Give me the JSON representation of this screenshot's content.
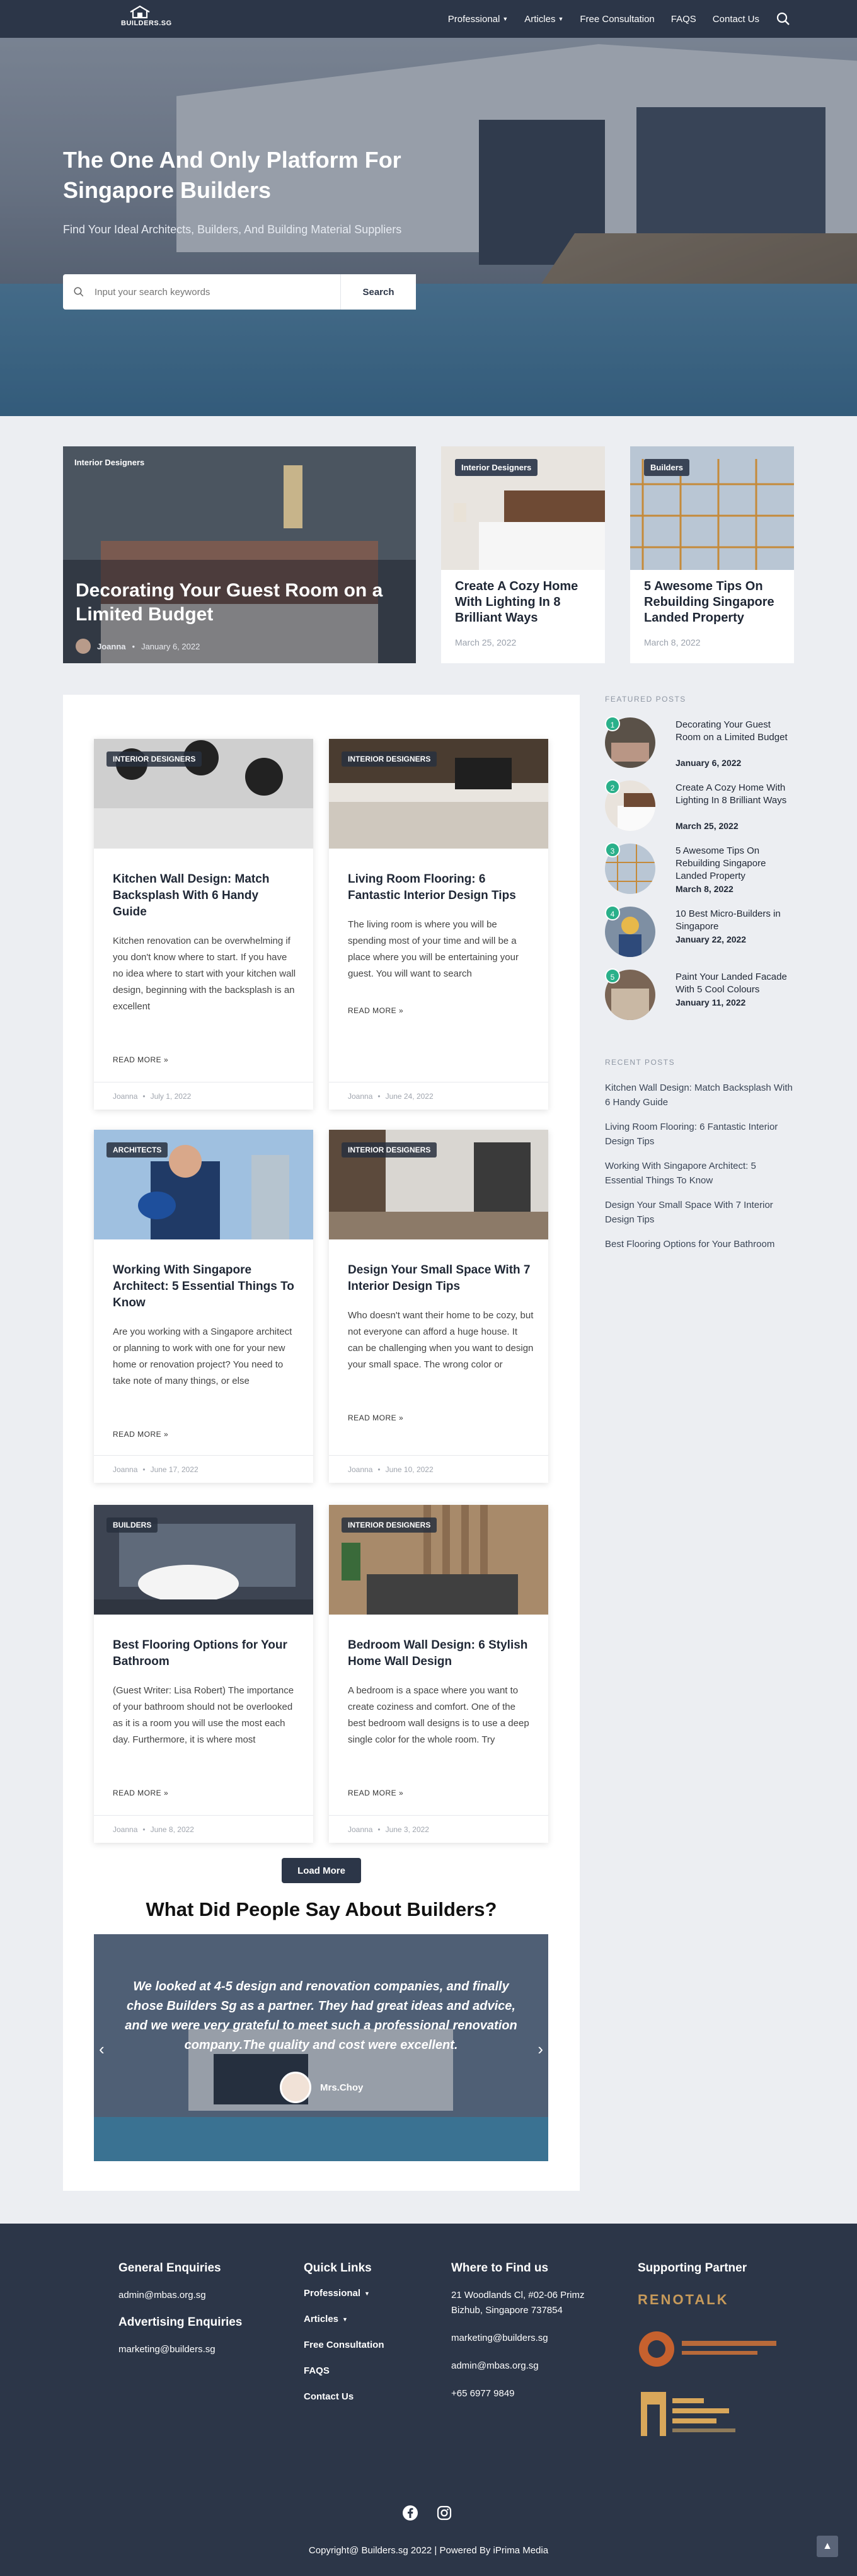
{
  "header": {
    "logo_text": "BUILDERS.SG",
    "nav": [
      {
        "label": "Professional",
        "dropdown": true
      },
      {
        "label": "Articles",
        "dropdown": true
      },
      {
        "label": "Free Consultation",
        "dropdown": false
      },
      {
        "label": "FAQS",
        "dropdown": false
      },
      {
        "label": "Contact Us",
        "dropdown": false
      }
    ]
  },
  "hero": {
    "title": "The One And Only Platform For Singapore Builders",
    "subtitle": "Find Your Ideal Architects, Builders, And Building Material Suppliers",
    "search_placeholder": "Input your search keywords",
    "search_button": "Search"
  },
  "featured": [
    {
      "category": "Interior Designers",
      "title": "Decorating Your Guest Room on a Limited Budget",
      "author": "Joanna",
      "date": "January 6, 2022"
    },
    {
      "category": "Interior Designers",
      "title": "Create A Cozy Home With Lighting In 8 Brilliant Ways",
      "date": "March 25, 2022"
    },
    {
      "category": "Builders",
      "title": "5 Awesome Tips On Rebuilding Singapore Landed Property",
      "date": "March 8, 2022"
    }
  ],
  "posts": [
    {
      "category": "INTERIOR DESIGNERS",
      "title": "Kitchen Wall Design: Match Backsplash With 6 Handy Guide",
      "excerpt": "Kitchen renovation can be overwhelming if you don't know where to start. If you have no idea where to start with your kitchen wall design, beginning with the backsplash is an excellent",
      "read_more": "READ MORE »",
      "author": "Joanna",
      "date": "July 1, 2022"
    },
    {
      "category": "INTERIOR DESIGNERS",
      "title": "Living Room Flooring: 6 Fantastic Interior Design Tips",
      "excerpt": "The living room is where you will be spending most of your time and will be a place where you will be entertaining your guest. You will want to search",
      "read_more": "READ MORE »",
      "author": "Joanna",
      "date": "June 24, 2022"
    },
    {
      "category": "ARCHITECTS",
      "title": "Working With Singapore Architect: 5 Essential Things To Know",
      "excerpt": "Are you working with a Singapore architect or planning to work with one for your new home or renovation project? You need to take note of many things, or else",
      "read_more": "READ MORE »",
      "author": "Joanna",
      "date": "June 17, 2022"
    },
    {
      "category": "INTERIOR DESIGNERS",
      "title": "Design Your Small Space With 7 Interior Design Tips",
      "excerpt": "Who doesn't want their home to be cozy, but not everyone can afford a huge house. It can be challenging when you want to design your small space. The wrong color or",
      "read_more": "READ MORE »",
      "author": "Joanna",
      "date": "June 10, 2022"
    },
    {
      "category": "BUILDERS",
      "title": "Best Flooring Options for Your Bathroom",
      "excerpt": "(Guest Writer: Lisa Robert) The importance of your bathroom should not be overlooked as it is a room you will use the most each day. Furthermore, it is where most",
      "read_more": "READ MORE »",
      "author": "Joanna",
      "date": "June 8, 2022"
    },
    {
      "category": "INTERIOR DESIGNERS",
      "title": "Bedroom Wall Design: 6 Stylish Home Wall Design",
      "excerpt": "A bedroom is a space where you want to create coziness and comfort. One of the best bedroom wall designs is to use a deep single color for the whole room. Try",
      "read_more": "READ MORE »",
      "author": "Joanna",
      "date": "June 3, 2022"
    }
  ],
  "load_more": "Load More",
  "testimonials": {
    "heading": "What Did People Say About Builders?",
    "quote": "We looked at 4-5 design and renovation companies, and finally chose Builders Sg as a partner. They had great ideas and advice, and we were very grateful to meet such a professional renovation company.The quality and cost were excellent.",
    "author": "Mrs.Choy"
  },
  "sidebar": {
    "featured_heading": "FEATURED POSTS",
    "featured": [
      {
        "num": "1",
        "title": "Decorating Your Guest Room on a Limited Budget",
        "date": "January 6, 2022"
      },
      {
        "num": "2",
        "title": "Create A Cozy Home With Lighting In 8 Brilliant Ways",
        "date": "March 25, 2022"
      },
      {
        "num": "3",
        "title": "5 Awesome Tips On Rebuilding Singapore Landed Property",
        "date": "March 8, 2022"
      },
      {
        "num": "4",
        "title": "10 Best Micro-Builders in Singapore",
        "date": "January 22, 2022"
      },
      {
        "num": "5",
        "title": "Paint Your Landed Facade With 5 Cool Colours",
        "date": "January 11, 2022"
      }
    ],
    "recent_heading": "RECENT POSTS",
    "recent": [
      "Kitchen Wall Design: Match Backsplash With 6 Handy Guide",
      "Living Room Flooring: 6 Fantastic Interior Design Tips",
      "Working With Singapore Architect: 5 Essential Things To Know",
      "Design Your Small Space With 7 Interior Design Tips",
      "Best Flooring Options for Your Bathroom"
    ]
  },
  "footer": {
    "general_heading": "General Enquiries",
    "general_email": "admin@mbas.org.sg",
    "advert_heading": "Advertising Enquiries",
    "advert_email": "marketing@builders.sg",
    "links_heading": "Quick Links",
    "links": [
      "Professional",
      "Articles",
      "Free Consultation",
      "FAQS",
      "Contact Us"
    ],
    "find_heading": "Where to Find us",
    "address": "21 Woodlands Cl, #02-06 Primz Bizhub, Singapore 737854",
    "email1": "marketing@builders.sg",
    "email2": "admin@mbas.org.sg",
    "phone": "+65 6977 9849",
    "partner_heading": "Supporting Partner",
    "partners": [
      "RENOTALK",
      "SINGAPORE RENO ASSOCIATION",
      "MBAS SINGAPORE"
    ],
    "copyright": "Copyright@ Builders.sg 2022 | Powered By iPrima Media"
  }
}
